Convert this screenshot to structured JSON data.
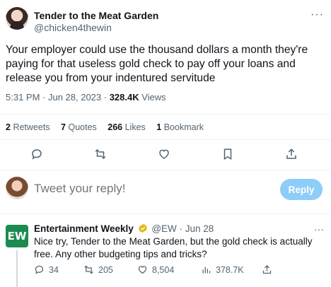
{
  "tweet": {
    "author_name": "Tender to the Meat Garden",
    "author_handle": "@chicken4thewin",
    "text": "Your employer could use the thousand dollars a month they're paying for that useless gold check to pay off your loans and release you from your indentured servitude",
    "time": "5:31 PM · Jun 28, 2023 · ",
    "views_count": "328.4K",
    "views_label": " Views",
    "more_label": "···"
  },
  "stats": {
    "retweets_count": "2",
    "retweets_label": "Retweets",
    "quotes_count": "7",
    "quotes_label": "Quotes",
    "likes_count": "266",
    "likes_label": "Likes",
    "bookmarks_count": "1",
    "bookmarks_label": "Bookmark"
  },
  "actions": {
    "icons": [
      "reply-icon",
      "retweet-icon",
      "like-icon",
      "bookmark-icon",
      "share-icon"
    ]
  },
  "reply": {
    "placeholder": "Tweet your reply!",
    "button_label": "Reply"
  },
  "ew_tweet": {
    "logo_text": "EW",
    "name": "Entertainment Weekly",
    "handle": "@EW",
    "date": " · Jun 28",
    "text": "Nice try, Tender to the Meat Garden, but the gold check is actually free. Any other budgeting tips and tricks?",
    "replies": "34",
    "retweets": "205",
    "likes": "8,504",
    "views": "378.7K",
    "more_label": "···"
  },
  "colors": {
    "accent": "#1d9bf0",
    "reply_button_disabled": "#8ecdf8",
    "secondary_text": "#536471",
    "ew_logo": "#1c8b4f",
    "verified_gold": "#e2b719"
  }
}
